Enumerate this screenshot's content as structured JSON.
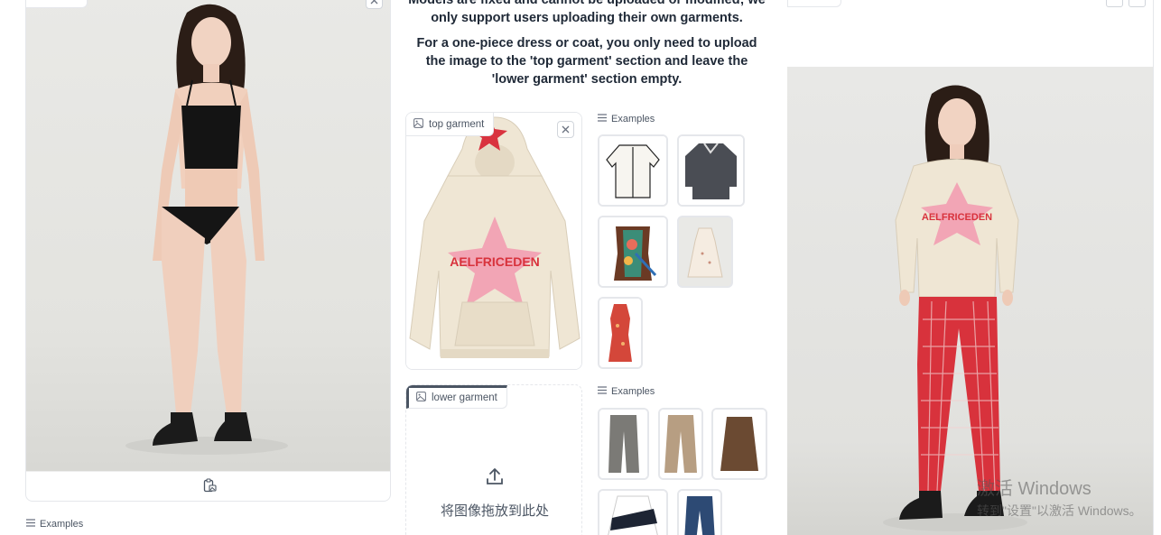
{
  "left_panel": {
    "footer_icon": "clipboard-image-icon",
    "examples_label": "Examples"
  },
  "notice": {
    "line1": "Models are fixed and cannot be uploaded or modified; we only support users uploading their own garments.",
    "line2": "For a one-piece dress or coat, you only need to upload the image to the 'top garment' section and leave the 'lower garment' section empty."
  },
  "top_garment": {
    "label": "top garment",
    "print_text": "AELFRICEDEN",
    "examples_label": "Examples"
  },
  "lower_garment": {
    "label": "lower garment",
    "drop_text": "将图像拖放到此处",
    "examples_label": "Examples"
  },
  "result": {
    "print_text": "AELFRICEDEN"
  },
  "watermark": {
    "line1": "激活 Windows",
    "line2": "转到\"设置\"以激活 Windows。"
  },
  "colors": {
    "border": "#e5e7eb",
    "hoodie": "#efe6d4",
    "star": "#f2a5b5",
    "pants_red": "#d8323c"
  }
}
